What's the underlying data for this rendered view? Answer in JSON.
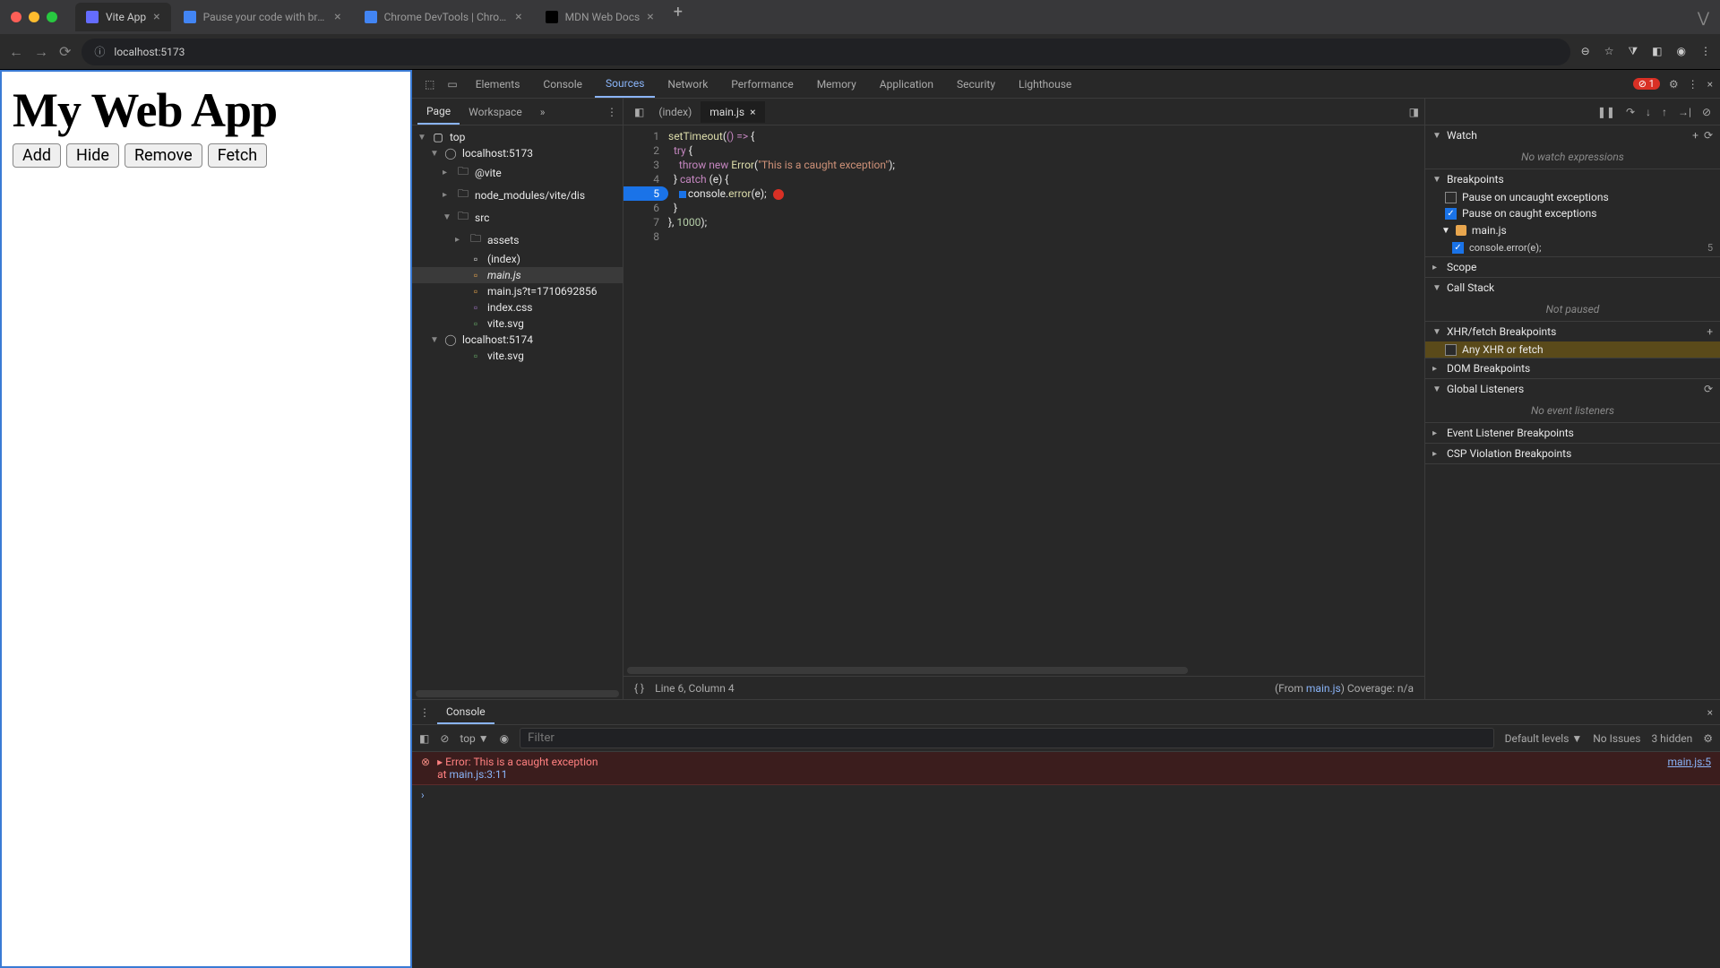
{
  "browser": {
    "tabs": [
      {
        "title": "Vite App",
        "fav": "#646cff",
        "active": true
      },
      {
        "title": "Pause your code with breakp",
        "fav": "#4285f4",
        "active": false
      },
      {
        "title": "Chrome DevTools | Chrome",
        "fav": "#4285f4",
        "active": false
      },
      {
        "title": "MDN Web Docs",
        "fav": "#000",
        "active": false
      }
    ],
    "url": "localhost:5173"
  },
  "page": {
    "heading": "My Web App",
    "buttons": [
      "Add",
      "Hide",
      "Remove",
      "Fetch"
    ]
  },
  "devtools": {
    "tabs": [
      "Elements",
      "Console",
      "Sources",
      "Network",
      "Performance",
      "Memory",
      "Application",
      "Security",
      "Lighthouse"
    ],
    "active_tab": "Sources",
    "error_count": "1",
    "sources": {
      "subtabs": [
        "Page",
        "Workspace"
      ],
      "tree": {
        "top": "top",
        "host1": "localhost:5173",
        "n_vite": "@vite",
        "n_node": "node_modules/vite/dis",
        "n_src": "src",
        "n_assets": "assets",
        "n_index": "(index)",
        "n_mainjs": "main.js",
        "n_mainjs_t": "main.js?t=1710692856",
        "n_indexcss": "index.css",
        "n_vitesvg": "vite.svg",
        "host2": "localhost:5174",
        "n_vitesvg2": "vite.svg"
      },
      "open_tabs": [
        "(index)",
        "main.js"
      ],
      "active_editor_tab": "main.js",
      "code_lines": [
        "setTimeout(() => {",
        "  try {",
        "    throw new Error(\"This is a caught exception\");",
        "  } catch (e) {",
        "    console.error(e);",
        "  }",
        "}, 1000);",
        ""
      ],
      "breakpoint_line": 5,
      "status_line": "Line 6, Column 4",
      "status_from": "(From ",
      "status_from_link": "main.js",
      "status_coverage": ")  Coverage: n/a"
    },
    "debugger": {
      "watch": {
        "title": "Watch",
        "empty": "No watch expressions"
      },
      "breakpoints": {
        "title": "Breakpoints",
        "uncaught": "Pause on uncaught exceptions",
        "caught": "Pause on caught exceptions",
        "file": "main.js",
        "code": "console.error(e);",
        "line": "5"
      },
      "scope": "Scope",
      "callstack": {
        "title": "Call Stack",
        "empty": "Not paused"
      },
      "xhr": {
        "title": "XHR/fetch Breakpoints",
        "any": "Any XHR or fetch"
      },
      "dom": "DOM Breakpoints",
      "global": {
        "title": "Global Listeners",
        "empty": "No event listeners"
      },
      "event": "Event Listener Breakpoints",
      "csp": "CSP Violation Breakpoints"
    },
    "console": {
      "tab": "Console",
      "context": "top",
      "filter_placeholder": "Filter",
      "levels": "Default levels",
      "issues": "No Issues",
      "hidden": "3 hidden",
      "error_msg": "Error: This is a caught exception",
      "error_at": "    at ",
      "error_loc": "main.js:3:11",
      "error_src": "main.js:5"
    }
  }
}
